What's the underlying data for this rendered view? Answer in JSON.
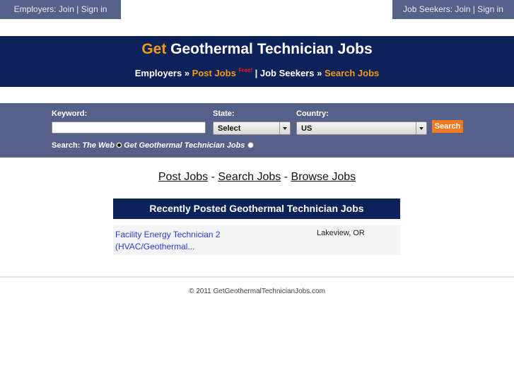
{
  "topbar": {
    "employers": {
      "prefix": "Employers: ",
      "join": "Join",
      "sep": " | ",
      "signin": "Sign in"
    },
    "jobseekers": {
      "prefix": "Job Seekers: ",
      "join": "Join",
      "sep": " | ",
      "signin": "Sign in"
    }
  },
  "header": {
    "title_accent": "Get",
    "title_rest": " Geothermal Technician Jobs",
    "nav": {
      "employers": "Employers",
      "raquo1": " » ",
      "post_jobs": "Post Jobs",
      "free": "Free!",
      "sep": " | ",
      "job_seekers": "Job Seekers",
      "raquo2": " » ",
      "search_jobs": "Search Jobs"
    }
  },
  "search": {
    "keyword_label": "Keyword:",
    "keyword_value": "",
    "state_label": "State:",
    "state_value": "Select",
    "country_label": "Country:",
    "country_value": "US",
    "button": "Search",
    "scope_label": "Search:",
    "scope_options": [
      "The Web",
      "Get Geothermal Technician Jobs"
    ],
    "scope_selected": "The Web"
  },
  "links": {
    "post": "Post Jobs",
    "sep1": " - ",
    "search": "Search Jobs",
    "sep2": " - ",
    "browse": "Browse Jobs"
  },
  "recent": {
    "heading": "Recently Posted Geothermal Technician Jobs",
    "jobs": [
      {
        "title": "Facility Energy Technician 2 (HVAC/Geothermal...",
        "location": "Lakeview, OR"
      }
    ]
  },
  "footer": {
    "copyright": "© 2011 GetGeothermalTechnicianJobs.com"
  },
  "colors": {
    "navy": "#0d2258",
    "slate": "#556189",
    "orange": "#f39a1c",
    "button_orange": "#f47a22",
    "link_blue": "#2d3bd1"
  }
}
